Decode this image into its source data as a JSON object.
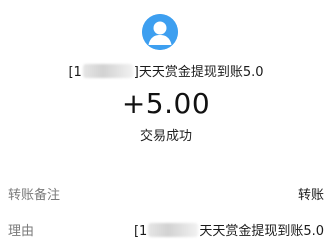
{
  "header": {
    "avatar_icon": "user-avatar-icon",
    "avatar_color": "#3d9ff0",
    "title_prefix": "[1",
    "title_suffix": "]天天赏金提现到账5.0"
  },
  "transaction": {
    "amount": "+5.00",
    "status": "交易成功"
  },
  "details": {
    "remark_label": "转账备注",
    "remark_value": "转账",
    "reason_label": "理由",
    "reason_prefix": "[1",
    "reason_suffix": "天天赏金提现到账5.0"
  }
}
